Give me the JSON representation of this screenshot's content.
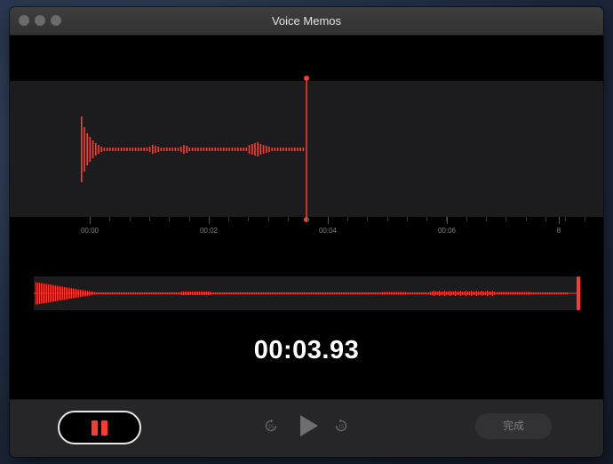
{
  "window": {
    "title": "Voice Memos"
  },
  "timeline": {
    "tick_labels": [
      "00:00",
      "00:02",
      "00:04",
      "00:06",
      "8"
    ]
  },
  "recording": {
    "elapsed_time": "00:03.93"
  },
  "controls": {
    "done_label": "完成",
    "skip_seconds": "15"
  },
  "colors": {
    "accent": "#ff3b30",
    "wave_panel": "#1c1c1e",
    "control_bar": "#262628"
  },
  "icons": {
    "pause": "pause-icon",
    "play": "play-icon",
    "skip_back": "skip-back-15-icon",
    "skip_forward": "skip-forward-15-icon"
  }
}
